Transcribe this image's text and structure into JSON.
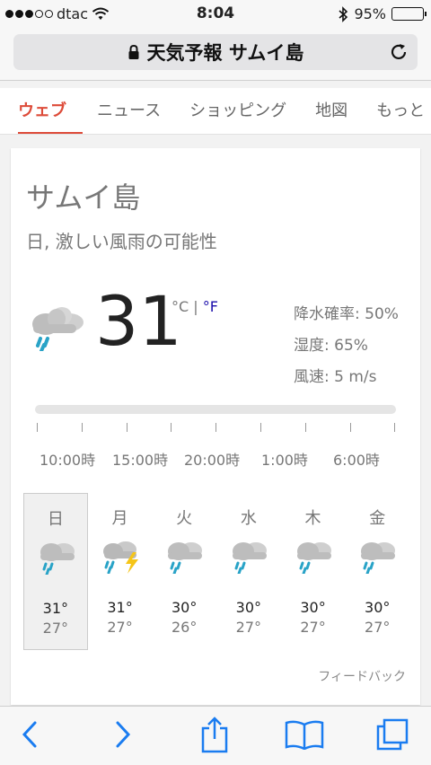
{
  "status": {
    "carrier": "dtac",
    "time": "8:04",
    "battery": "95%",
    "battery_level": 0.95,
    "signal_bars": 3
  },
  "address": {
    "title": "天気予報 サムイ島"
  },
  "tabs": [
    {
      "label": "ウェブ"
    },
    {
      "label": "ニュース"
    },
    {
      "label": "ショッピング"
    },
    {
      "label": "地図"
    },
    {
      "label": "もっと"
    }
  ],
  "weather": {
    "location": "サムイ島",
    "condition": "日, 激しい風雨の可能性",
    "temperature": "31",
    "unit_c": "°C",
    "unit_sep": "|",
    "unit_f": "°F",
    "precip": "降水確率: 50%",
    "humidity": "湿度: 65%",
    "wind": "風速: 5 m/s",
    "hours": [
      "10:00時",
      "15:00時",
      "20:00時",
      "1:00時",
      "6:00時"
    ],
    "days": [
      {
        "name": "日",
        "hi": "31°",
        "lo": "27°",
        "icon": "rain-cloud-icon"
      },
      {
        "name": "月",
        "hi": "31°",
        "lo": "27°",
        "icon": "thunderstorm-icon"
      },
      {
        "name": "火",
        "hi": "30°",
        "lo": "26°",
        "icon": "rain-cloud-icon"
      },
      {
        "name": "水",
        "hi": "30°",
        "lo": "27°",
        "icon": "rain-cloud-icon"
      },
      {
        "name": "木",
        "hi": "30°",
        "lo": "27°",
        "icon": "rain-cloud-icon"
      },
      {
        "name": "金",
        "hi": "30°",
        "lo": "27°",
        "icon": "rain-cloud-icon"
      }
    ],
    "feedback": "フィードバック"
  },
  "colors": {
    "accent": "#dd4b39",
    "ios_blue": "#1a7cf0",
    "link_blue": "#1a0dab",
    "rain": "#29a3c7",
    "bolt": "#f5c518"
  }
}
